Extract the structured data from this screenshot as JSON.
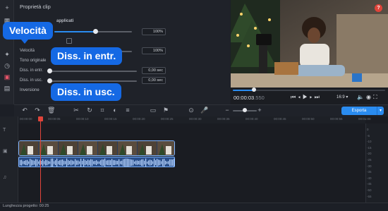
{
  "props": {
    "title": "Proprietà clip",
    "filters_header": "applicati",
    "labels": {
      "velocita": "Velocità",
      "tono": "Tono originale",
      "diss_entr": "Diss. in entr.",
      "diss_usc": "Diss. in usc.",
      "inversione": "Inversione"
    },
    "values": {
      "speed_top": "100%",
      "speed": "100%",
      "fade_in": "0,00 sec",
      "fade_out": "0,00 sec"
    },
    "sliders": {
      "speed_top": 0.53,
      "speed": 0.53,
      "fade_in": 0.0,
      "fade_out": 0.0
    }
  },
  "callouts": {
    "velocita": "Velocità",
    "diss_entr": "Diss. in entr.",
    "diss_usc": "Diss. in usc."
  },
  "preview": {
    "timecode": "00:00:03",
    "timecode_frac": ".550",
    "aspect": "16:9",
    "progress": 0.14,
    "help_icon": "?"
  },
  "toolbar": {
    "export_label": "Esporta"
  },
  "timeline": {
    "ruler": [
      "00:00:00",
      "00:00:05",
      "00:00:10",
      "00:00:15",
      "00:00:20",
      "00:00:25",
      "00:00:30",
      "00:00:35",
      "00:00:40",
      "00:00:45",
      "00:00:50",
      "00:00:55",
      "00:01:00"
    ],
    "meter_labels": [
      "0",
      "-5",
      "-10",
      "-15",
      "-20",
      "-25",
      "-30",
      "-35",
      "-40",
      "-45",
      "-50",
      "-55"
    ]
  },
  "status": {
    "label": "Lunghezza progetto: 00:25"
  },
  "colors": {
    "accent": "#2a8cf0",
    "callout": "#1569e4",
    "playhead": "#e0443a",
    "clip_border": "#7fb4ff"
  }
}
